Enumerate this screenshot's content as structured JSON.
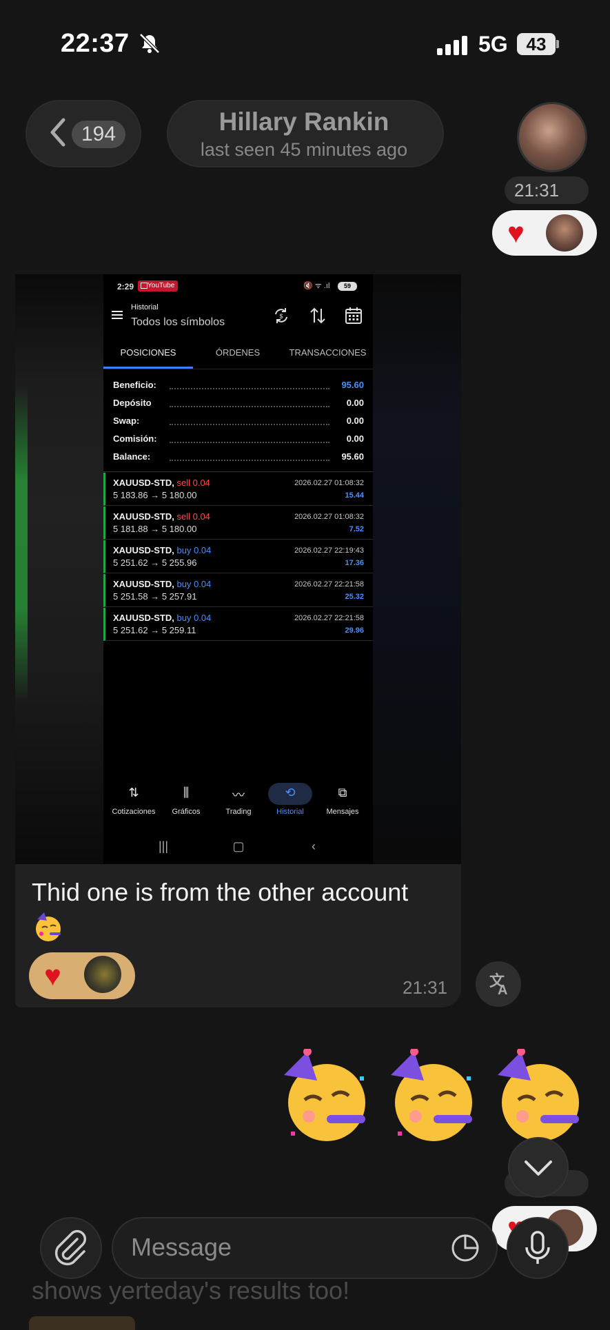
{
  "status_bar": {
    "time": "22:37",
    "network": "5G",
    "battery": "43"
  },
  "header": {
    "back_count": "194",
    "name": "Hillary Rankin",
    "last_seen": "last seen 45 minutes ago"
  },
  "top_message": {
    "time": "21:31"
  },
  "screenshot": {
    "status_time": "2:29",
    "youtube_label": "YouTube",
    "battery": "59",
    "title_small": "Historial",
    "title": "Todos los símbolos",
    "tabs": [
      "POSICIONES",
      "ÓRDENES",
      "TRANSACCIONES"
    ],
    "summary": [
      {
        "label": "Beneficio:",
        "value": "95.60",
        "highlight": true
      },
      {
        "label": "Depósito",
        "value": "0.00"
      },
      {
        "label": "Swap:",
        "value": "0.00"
      },
      {
        "label": "Comisión:",
        "value": "0.00"
      },
      {
        "label": "Balance:",
        "value": "95.60"
      }
    ],
    "trades": [
      {
        "symbol": "XAUUSD-STD,",
        "direction": "sell",
        "volume": "0.04",
        "prices": "5 183.86 → 5 180.00",
        "date": "2026.02.27 01:08:32",
        "profit": "15.44"
      },
      {
        "symbol": "XAUUSD-STD,",
        "direction": "sell",
        "volume": "0.04",
        "prices": "5 181.88 → 5 180.00",
        "date": "2026.02.27 01:08:32",
        "profit": "7.52"
      },
      {
        "symbol": "XAUUSD-STD,",
        "direction": "buy",
        "volume": "0.04",
        "prices": "5 251.62 → 5 255.96",
        "date": "2026.02.27 22:19:43",
        "profit": "17.36"
      },
      {
        "symbol": "XAUUSD-STD,",
        "direction": "buy",
        "volume": "0.04",
        "prices": "5 251.58 → 5 257.91",
        "date": "2026.02.27 22:21:58",
        "profit": "25.32"
      },
      {
        "symbol": "XAUUSD-STD,",
        "direction": "buy",
        "volume": "0.04",
        "prices": "5 251.62 → 5 259.11",
        "date": "2026.02.27 22:21:58",
        "profit": "29.96"
      }
    ],
    "nav": [
      "Cotizaciones",
      "Gráficos",
      "Trading",
      "Historial",
      "Mensajes"
    ],
    "nav_active": "Historial"
  },
  "photo_message": {
    "text": "Thid one is from the other account",
    "time": "21:31"
  },
  "composer": {
    "placeholder": "Message"
  },
  "ghost_message": {
    "text": "shows yerteday's results too!"
  },
  "colors": {
    "background": "#151515",
    "reaction_gold": "#d9ae72",
    "heart": "#e1121f",
    "positive": "#4a90ff",
    "sell": "#ff4a4a",
    "accent": "#3b82f6"
  }
}
